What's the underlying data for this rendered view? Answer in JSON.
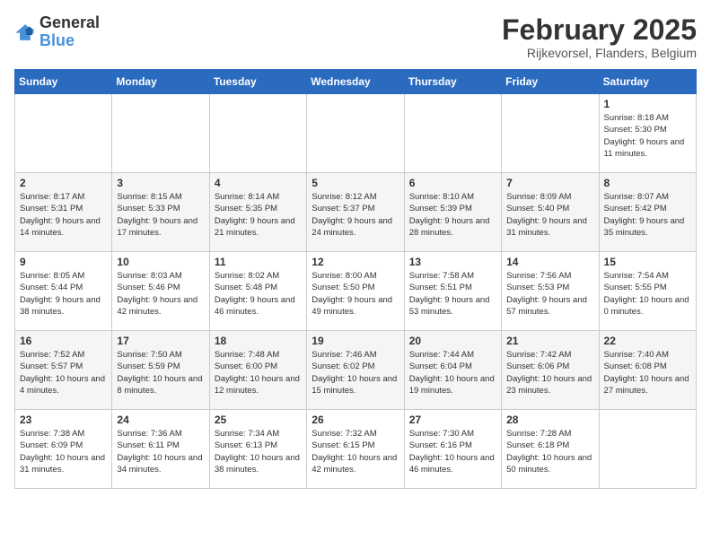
{
  "logo": {
    "general": "General",
    "blue": "Blue"
  },
  "title": {
    "month_year": "February 2025",
    "location": "Rijkevorsel, Flanders, Belgium"
  },
  "weekdays": [
    "Sunday",
    "Monday",
    "Tuesday",
    "Wednesday",
    "Thursday",
    "Friday",
    "Saturday"
  ],
  "weeks": [
    [
      {
        "day": "",
        "info": ""
      },
      {
        "day": "",
        "info": ""
      },
      {
        "day": "",
        "info": ""
      },
      {
        "day": "",
        "info": ""
      },
      {
        "day": "",
        "info": ""
      },
      {
        "day": "",
        "info": ""
      },
      {
        "day": "1",
        "info": "Sunrise: 8:18 AM\nSunset: 5:30 PM\nDaylight: 9 hours and 11 minutes."
      }
    ],
    [
      {
        "day": "2",
        "info": "Sunrise: 8:17 AM\nSunset: 5:31 PM\nDaylight: 9 hours and 14 minutes."
      },
      {
        "day": "3",
        "info": "Sunrise: 8:15 AM\nSunset: 5:33 PM\nDaylight: 9 hours and 17 minutes."
      },
      {
        "day": "4",
        "info": "Sunrise: 8:14 AM\nSunset: 5:35 PM\nDaylight: 9 hours and 21 minutes."
      },
      {
        "day": "5",
        "info": "Sunrise: 8:12 AM\nSunset: 5:37 PM\nDaylight: 9 hours and 24 minutes."
      },
      {
        "day": "6",
        "info": "Sunrise: 8:10 AM\nSunset: 5:39 PM\nDaylight: 9 hours and 28 minutes."
      },
      {
        "day": "7",
        "info": "Sunrise: 8:09 AM\nSunset: 5:40 PM\nDaylight: 9 hours and 31 minutes."
      },
      {
        "day": "8",
        "info": "Sunrise: 8:07 AM\nSunset: 5:42 PM\nDaylight: 9 hours and 35 minutes."
      }
    ],
    [
      {
        "day": "9",
        "info": "Sunrise: 8:05 AM\nSunset: 5:44 PM\nDaylight: 9 hours and 38 minutes."
      },
      {
        "day": "10",
        "info": "Sunrise: 8:03 AM\nSunset: 5:46 PM\nDaylight: 9 hours and 42 minutes."
      },
      {
        "day": "11",
        "info": "Sunrise: 8:02 AM\nSunset: 5:48 PM\nDaylight: 9 hours and 46 minutes."
      },
      {
        "day": "12",
        "info": "Sunrise: 8:00 AM\nSunset: 5:50 PM\nDaylight: 9 hours and 49 minutes."
      },
      {
        "day": "13",
        "info": "Sunrise: 7:58 AM\nSunset: 5:51 PM\nDaylight: 9 hours and 53 minutes."
      },
      {
        "day": "14",
        "info": "Sunrise: 7:56 AM\nSunset: 5:53 PM\nDaylight: 9 hours and 57 minutes."
      },
      {
        "day": "15",
        "info": "Sunrise: 7:54 AM\nSunset: 5:55 PM\nDaylight: 10 hours and 0 minutes."
      }
    ],
    [
      {
        "day": "16",
        "info": "Sunrise: 7:52 AM\nSunset: 5:57 PM\nDaylight: 10 hours and 4 minutes."
      },
      {
        "day": "17",
        "info": "Sunrise: 7:50 AM\nSunset: 5:59 PM\nDaylight: 10 hours and 8 minutes."
      },
      {
        "day": "18",
        "info": "Sunrise: 7:48 AM\nSunset: 6:00 PM\nDaylight: 10 hours and 12 minutes."
      },
      {
        "day": "19",
        "info": "Sunrise: 7:46 AM\nSunset: 6:02 PM\nDaylight: 10 hours and 15 minutes."
      },
      {
        "day": "20",
        "info": "Sunrise: 7:44 AM\nSunset: 6:04 PM\nDaylight: 10 hours and 19 minutes."
      },
      {
        "day": "21",
        "info": "Sunrise: 7:42 AM\nSunset: 6:06 PM\nDaylight: 10 hours and 23 minutes."
      },
      {
        "day": "22",
        "info": "Sunrise: 7:40 AM\nSunset: 6:08 PM\nDaylight: 10 hours and 27 minutes."
      }
    ],
    [
      {
        "day": "23",
        "info": "Sunrise: 7:38 AM\nSunset: 6:09 PM\nDaylight: 10 hours and 31 minutes."
      },
      {
        "day": "24",
        "info": "Sunrise: 7:36 AM\nSunset: 6:11 PM\nDaylight: 10 hours and 34 minutes."
      },
      {
        "day": "25",
        "info": "Sunrise: 7:34 AM\nSunset: 6:13 PM\nDaylight: 10 hours and 38 minutes."
      },
      {
        "day": "26",
        "info": "Sunrise: 7:32 AM\nSunset: 6:15 PM\nDaylight: 10 hours and 42 minutes."
      },
      {
        "day": "27",
        "info": "Sunrise: 7:30 AM\nSunset: 6:16 PM\nDaylight: 10 hours and 46 minutes."
      },
      {
        "day": "28",
        "info": "Sunrise: 7:28 AM\nSunset: 6:18 PM\nDaylight: 10 hours and 50 minutes."
      },
      {
        "day": "",
        "info": ""
      }
    ]
  ]
}
